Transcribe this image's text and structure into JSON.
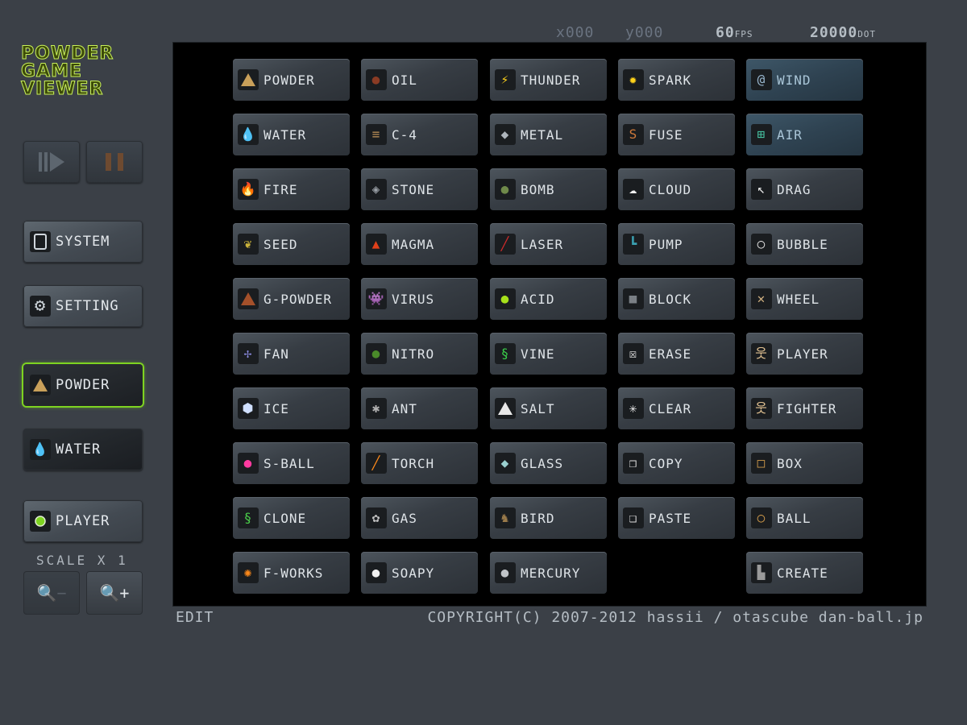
{
  "app": {
    "title_lines": [
      "POWDER",
      "GAME",
      "VIEWER"
    ]
  },
  "hud": {
    "x": "x000",
    "y": "y000",
    "fps": "60",
    "fps_unit": "FPS",
    "dot": "20000",
    "dot_unit": "DOT"
  },
  "playback": {
    "play_icon": "play-step-icon",
    "pause_icon": "pause-icon"
  },
  "sidebar": {
    "system": "SYSTEM",
    "setting": "SETTING",
    "current1": "POWDER",
    "current2": "WATER",
    "player": "PLAYER"
  },
  "scale": {
    "label": "SCALE X 1",
    "zoom_out": "−",
    "zoom_in": "+"
  },
  "elements": [
    [
      "POWDER",
      "OIL",
      "THUNDER",
      "SPARK",
      "WIND"
    ],
    [
      "WATER",
      "C-4",
      "METAL",
      "FUSE",
      "AIR"
    ],
    [
      "FIRE",
      "STONE",
      "BOMB",
      "CLOUD",
      "DRAG"
    ],
    [
      "SEED",
      "MAGMA",
      "LASER",
      "PUMP",
      "BUBBLE"
    ],
    [
      "G-POWDER",
      "VIRUS",
      "ACID",
      "BLOCK",
      "WHEEL"
    ],
    [
      "FAN",
      "NITRO",
      "VINE",
      "ERASE",
      "PLAYER"
    ],
    [
      "ICE",
      "ANT",
      "SALT",
      "CLEAR",
      "FIGHTER"
    ],
    [
      "S-BALL",
      "TORCH",
      "GLASS",
      "COPY",
      "BOX"
    ],
    [
      "CLONE",
      "GAS",
      "BIRD",
      "PASTE",
      "BALL"
    ],
    [
      "F-WORKS",
      "SOAPY",
      "MERCURY",
      "",
      "CREATE"
    ]
  ],
  "footer": {
    "mode": "EDIT",
    "copyright": "COPYRIGHT(C)  2007-2012 hassii / otascube  dan-ball.jp"
  }
}
